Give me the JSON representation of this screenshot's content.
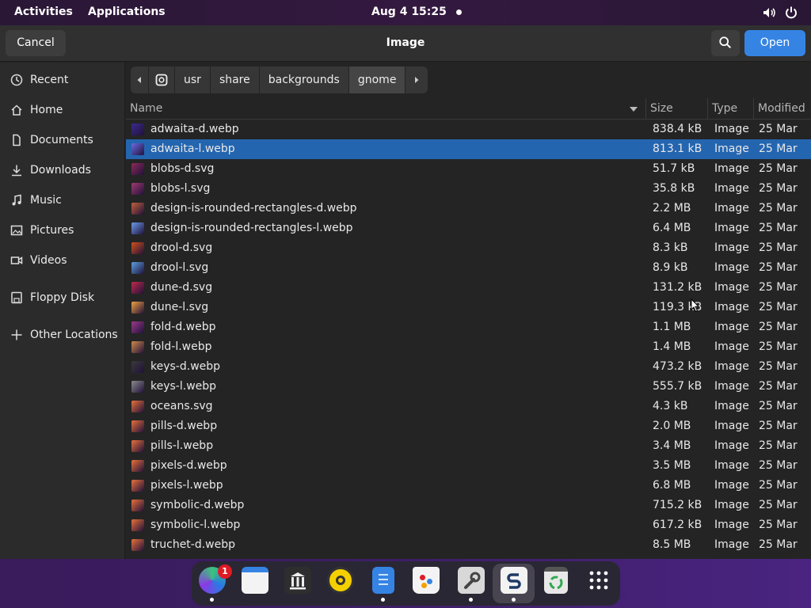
{
  "topbar": {
    "activities": "Activities",
    "applications": "Applications",
    "clock": "Aug 4  15:25"
  },
  "header": {
    "cancel": "Cancel",
    "title": "Image",
    "open": "Open"
  },
  "sidebar": {
    "items": [
      {
        "label": "Recent",
        "icon": "clock-icon"
      },
      {
        "label": "Home",
        "icon": "home-icon"
      },
      {
        "label": "Documents",
        "icon": "document-icon"
      },
      {
        "label": "Downloads",
        "icon": "download-icon"
      },
      {
        "label": "Music",
        "icon": "music-icon"
      },
      {
        "label": "Pictures",
        "icon": "picture-icon"
      },
      {
        "label": "Videos",
        "icon": "video-icon"
      },
      {
        "label": "Floppy Disk",
        "icon": "floppy-icon"
      },
      {
        "label": "Other Locations",
        "icon": "plus-icon"
      }
    ]
  },
  "pathbar": {
    "segments": [
      "usr",
      "share",
      "backgrounds",
      "gnome"
    ]
  },
  "columns": {
    "name": "Name",
    "size": "Size",
    "type": "Type",
    "modified": "Modified"
  },
  "files": [
    {
      "name": "adwaita-d.webp",
      "size": "838.4 kB",
      "type": "Image",
      "modified": "25 Mar",
      "thumb": "#3a2a8c"
    },
    {
      "name": "adwaita-l.webp",
      "size": "813.1 kB",
      "type": "Image",
      "modified": "25 Mar",
      "thumb": "#6a6ae0"
    },
    {
      "name": "blobs-d.svg",
      "size": "51.7 kB",
      "type": "Image",
      "modified": "25 Mar",
      "thumb": "#8c2a5a"
    },
    {
      "name": "blobs-l.svg",
      "size": "35.8 kB",
      "type": "Image",
      "modified": "25 Mar",
      "thumb": "#a03a70"
    },
    {
      "name": "design-is-rounded-rectangles-d.webp",
      "size": "2.2 MB",
      "type": "Image",
      "modified": "25 Mar",
      "thumb": "#c0603a"
    },
    {
      "name": "design-is-rounded-rectangles-l.webp",
      "size": "6.4 MB",
      "type": "Image",
      "modified": "25 Mar",
      "thumb": "#6a9ae8"
    },
    {
      "name": "drool-d.svg",
      "size": "8.3 kB",
      "type": "Image",
      "modified": "25 Mar",
      "thumb": "#d0501a"
    },
    {
      "name": "drool-l.svg",
      "size": "8.9 kB",
      "type": "Image",
      "modified": "25 Mar",
      "thumb": "#5aa0e0"
    },
    {
      "name": "dune-d.svg",
      "size": "131.2 kB",
      "type": "Image",
      "modified": "25 Mar",
      "thumb": "#c02a4a"
    },
    {
      "name": "dune-l.svg",
      "size": "119.3 kB",
      "type": "Image",
      "modified": "25 Mar",
      "thumb": "#f0a040"
    },
    {
      "name": "fold-d.webp",
      "size": "1.1 MB",
      "type": "Image",
      "modified": "25 Mar",
      "thumb": "#9a3a8a"
    },
    {
      "name": "fold-l.webp",
      "size": "1.4 MB",
      "type": "Image",
      "modified": "25 Mar",
      "thumb": "#d08a4a"
    },
    {
      "name": "keys-d.webp",
      "size": "473.2 kB",
      "type": "Image",
      "modified": "25 Mar",
      "thumb": "#3a3a3a"
    },
    {
      "name": "keys-l.webp",
      "size": "555.7 kB",
      "type": "Image",
      "modified": "25 Mar",
      "thumb": "#8a8a8a"
    },
    {
      "name": "oceans.svg",
      "size": "4.3 kB",
      "type": "Image",
      "modified": "25 Mar",
      "thumb": "#e8703a"
    },
    {
      "name": "pills-d.webp",
      "size": "2.0 MB",
      "type": "Image",
      "modified": "25 Mar",
      "thumb": "#e8703a"
    },
    {
      "name": "pills-l.webp",
      "size": "3.4 MB",
      "type": "Image",
      "modified": "25 Mar",
      "thumb": "#e8703a"
    },
    {
      "name": "pixels-d.webp",
      "size": "3.5 MB",
      "type": "Image",
      "modified": "25 Mar",
      "thumb": "#e8703a"
    },
    {
      "name": "pixels-l.webp",
      "size": "6.8 MB",
      "type": "Image",
      "modified": "25 Mar",
      "thumb": "#e8703a"
    },
    {
      "name": "symbolic-d.webp",
      "size": "715.2 kB",
      "type": "Image",
      "modified": "25 Mar",
      "thumb": "#e8703a"
    },
    {
      "name": "symbolic-l.webp",
      "size": "617.2 kB",
      "type": "Image",
      "modified": "25 Mar",
      "thumb": "#e8703a"
    },
    {
      "name": "truchet-d.webp",
      "size": "8.5 MB",
      "type": "Image",
      "modified": "25 Mar",
      "thumb": "#e8703a"
    }
  ],
  "selected_file": "adwaita-l.webp",
  "dock": {
    "badge": "1",
    "apps": [
      "browser",
      "calendar",
      "archive-manager",
      "rhythmbox",
      "text-editor",
      "software-center",
      "settings",
      "screenshot",
      "trash",
      "app-grid"
    ]
  },
  "colors": {
    "accent": "#3584e4",
    "selection": "#2465b0",
    "badge": "#e01b24"
  }
}
